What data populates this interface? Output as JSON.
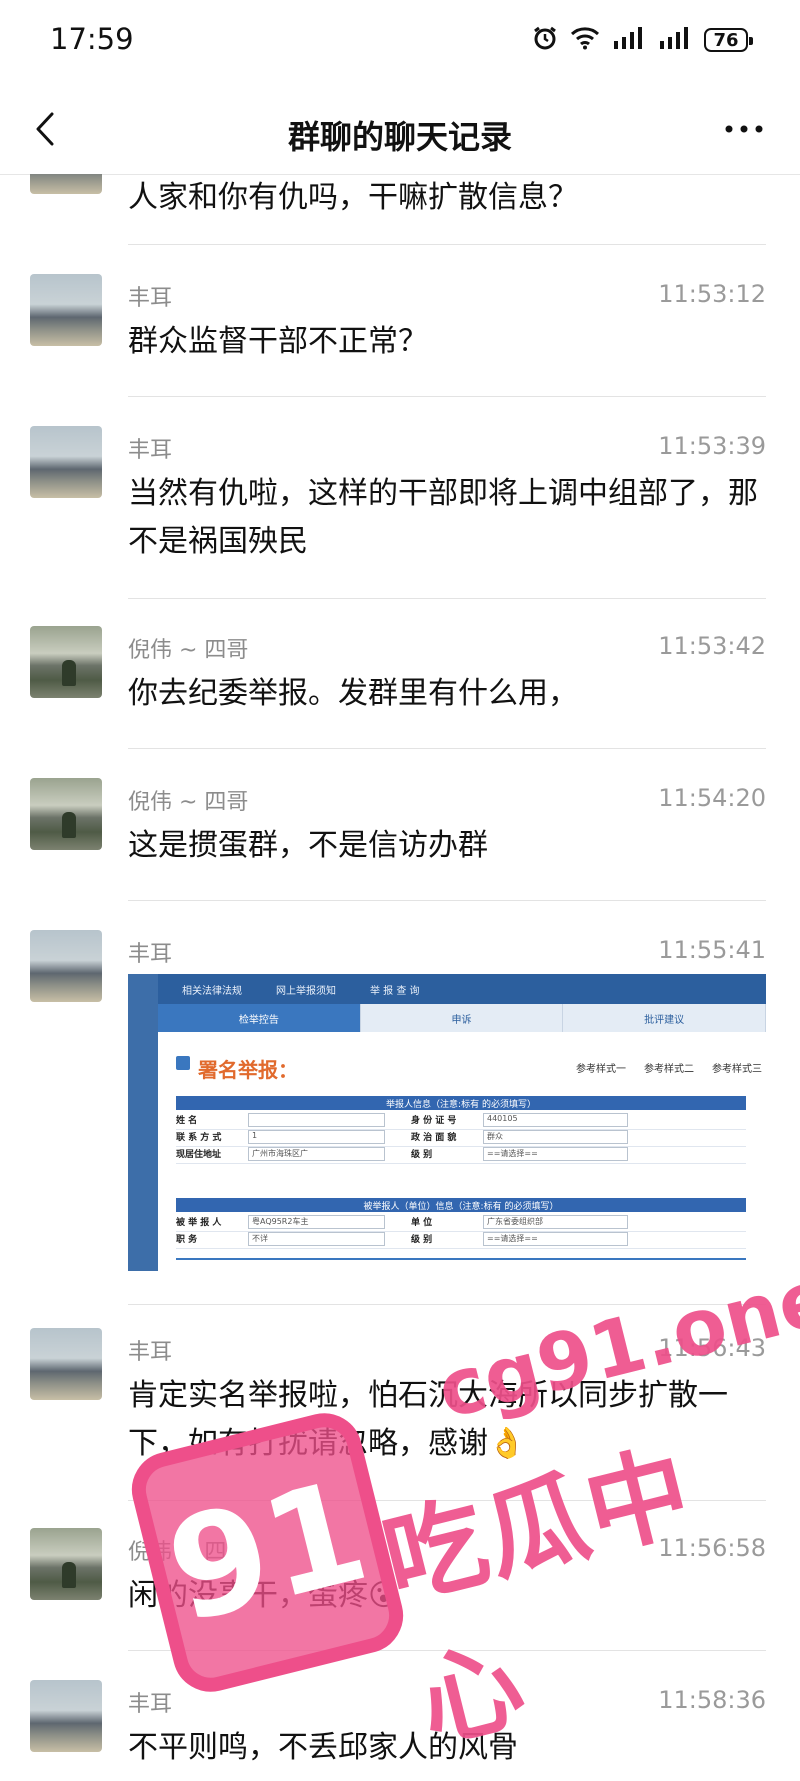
{
  "status_bar": {
    "time": "17:59",
    "battery": "76"
  },
  "nav": {
    "title": "群聊的聊天记录"
  },
  "messages": [
    {
      "text": "人家和你有仇吗，干嘛扩散信息？"
    },
    {
      "name": "丰耳",
      "time": "11:53:12",
      "text": "群众监督干部不正常？"
    },
    {
      "name": "丰耳",
      "time": "11:53:39",
      "text": "当然有仇啦，这样的干部即将上调中组部了，那不是祸国殃民"
    },
    {
      "name": "倪伟 ~ 四哥",
      "time": "11:53:42",
      "text": "你去纪委举报。发群里有什么用，"
    },
    {
      "name": "倪伟 ~ 四哥",
      "time": "11:54:20",
      "text": "这是掼蛋群，不是信访办群"
    },
    {
      "name": "丰耳",
      "time": "11:55:41",
      "image": {
        "topbar": [
          "相关法律法规",
          "网上举报须知",
          "举 报 查 询"
        ],
        "tabs": [
          "检举控告",
          "申诉",
          "批评建议"
        ],
        "title": "署名举报：",
        "refs": [
          "参考样式一",
          "参考样式二",
          "参考样式三"
        ],
        "section1": "举报人信息（注意:标有  的必须填写）",
        "rows1": [
          {
            "l1": "姓      名",
            "v1": "",
            "l2": "身 份 证 号",
            "v2": "440105"
          },
          {
            "l1": "联 系 方 式",
            "v1": "1",
            "l2": "政 治 面 貌",
            "v2": "群众"
          },
          {
            "l1": "现居住地址",
            "v1": "广州市海珠区广",
            "l2": "级      别",
            "v2": "==请选择=="
          }
        ],
        "section2": "被举报人（单位）信息（注意:标有  的必须填写）",
        "rows2": [
          {
            "l1": "被 举 报 人",
            "v1": "粤AQ95R2车主",
            "l2": "单      位",
            "v2": "广东省委组织部"
          },
          {
            "l1": "职      务",
            "v1": "不详",
            "l2": "级      别",
            "v2": "==请选择=="
          }
        ]
      }
    },
    {
      "name": "丰耳",
      "time": "11:56:43",
      "text": "肯定实名举报啦，怕石沉大海所以同步扩散一下，如有打扰请忽略，感谢👌"
    },
    {
      "name": "倪伟 ~ 四哥",
      "time": "11:56:58",
      "text": "闲的没事干，蛋疼😮"
    },
    {
      "name": "丰耳",
      "time": "11:58:36",
      "text": "不平则鸣，不丢邱家人的风骨"
    }
  ],
  "watermark": {
    "badge": "91",
    "url": "cg91.one",
    "name": "吃瓜中心"
  },
  "colors": {
    "accent": "#ee4f8a",
    "link_blue": "#3a77bf"
  }
}
